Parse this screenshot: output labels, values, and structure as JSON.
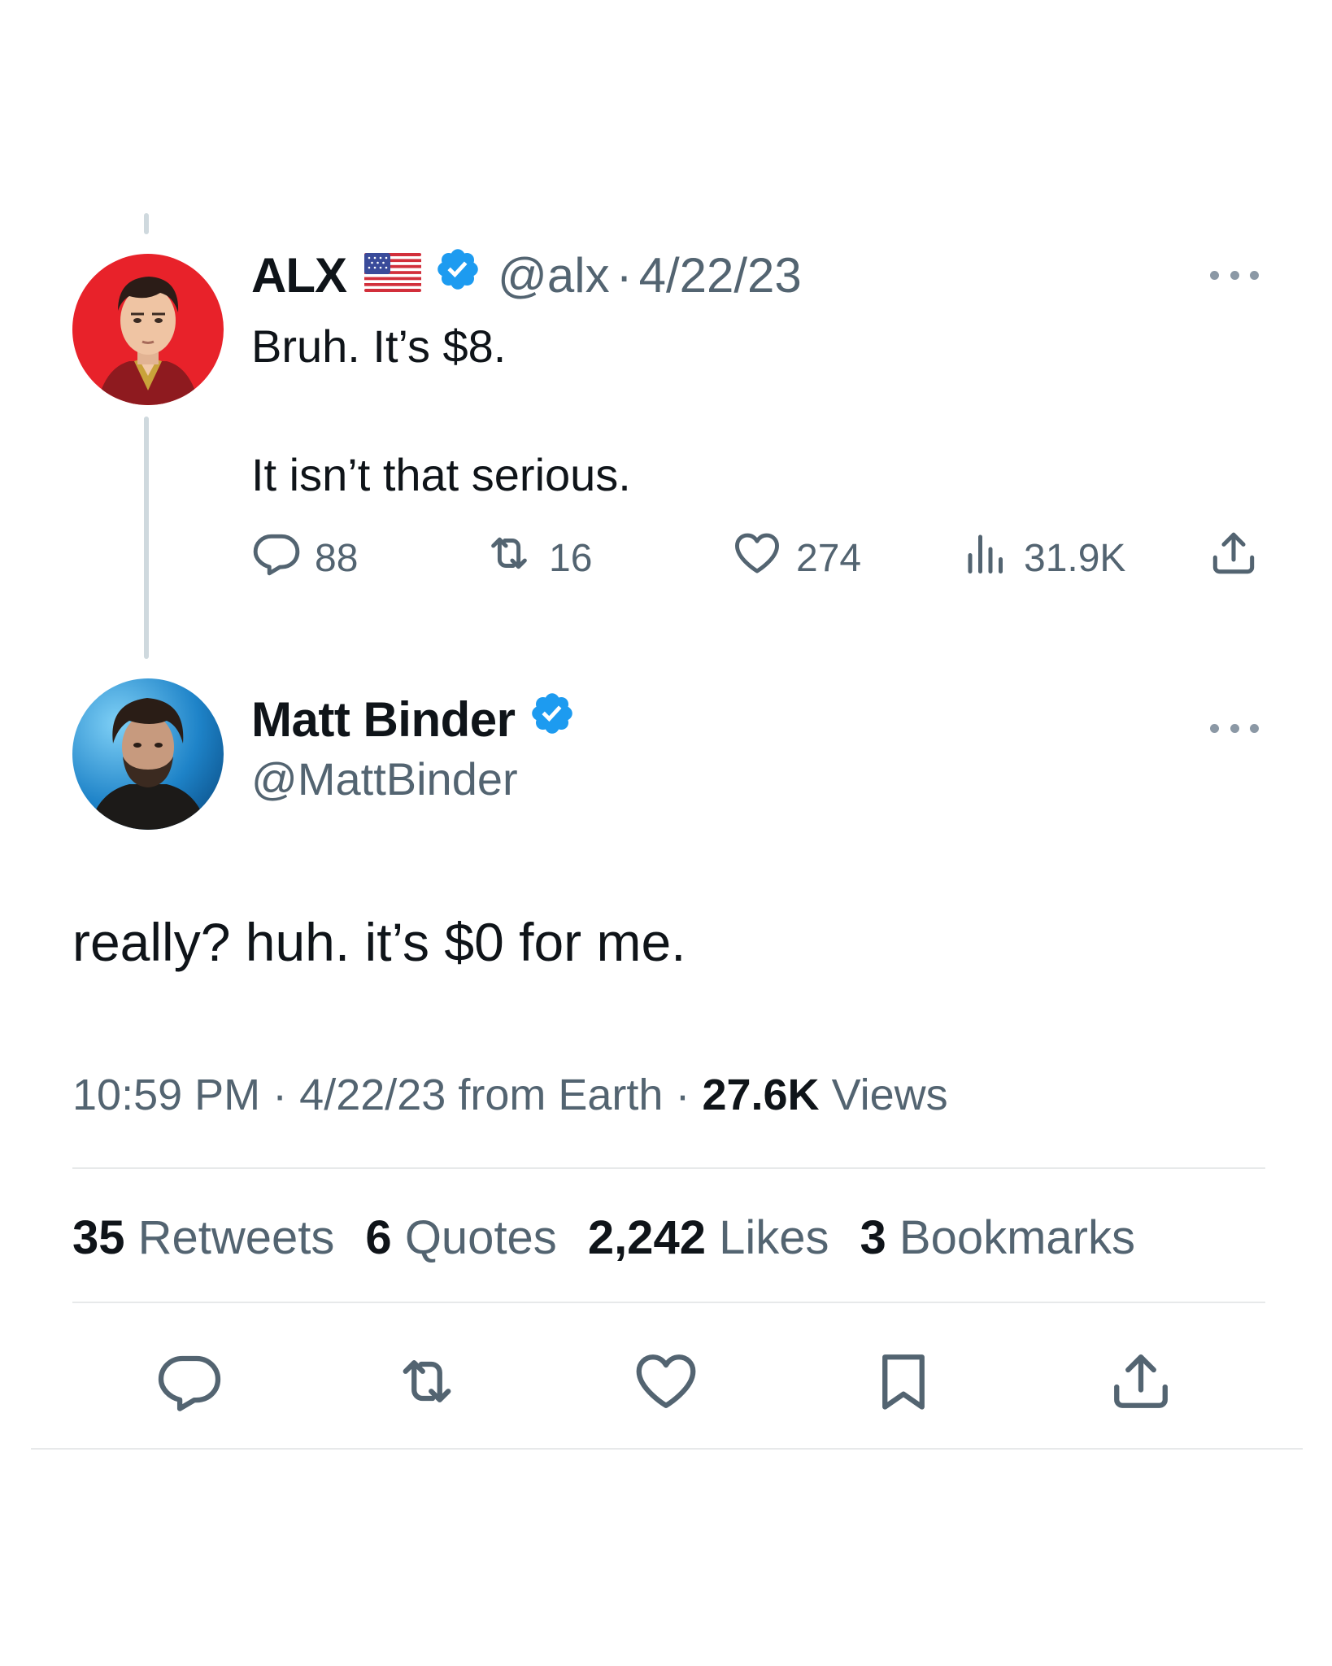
{
  "parent_tweet": {
    "display_name": "ALX",
    "flag_icon": "us-flag-icon",
    "handle": "@alx",
    "separator": "·",
    "date": "4/22/23",
    "text_line1": "Bruh. It’s $8.",
    "text_line2": "It isn’t that serious.",
    "replies": "88",
    "retweets": "16",
    "likes": "274",
    "views": "31.9K"
  },
  "main_tweet": {
    "display_name": "Matt Binder",
    "handle": "@MattBinder",
    "text": "really? huh. it’s $0 for me.",
    "time": "10:59 PM",
    "separator": "·",
    "date": "4/22/23",
    "source": "from Earth",
    "views_count": "27.6K",
    "views_label": "Views"
  },
  "stats": {
    "retweets_count": "35",
    "retweets_label": "Retweets",
    "quotes_count": "6",
    "quotes_label": "Quotes",
    "likes_count": "2,242",
    "likes_label": "Likes",
    "bookmarks_count": "3",
    "bookmarks_label": "Bookmarks"
  },
  "colors": {
    "verified_blue": "#1d9bf0",
    "muted_text": "#536471",
    "primary_text": "#0f1419",
    "divider": "#e7e9ea"
  }
}
